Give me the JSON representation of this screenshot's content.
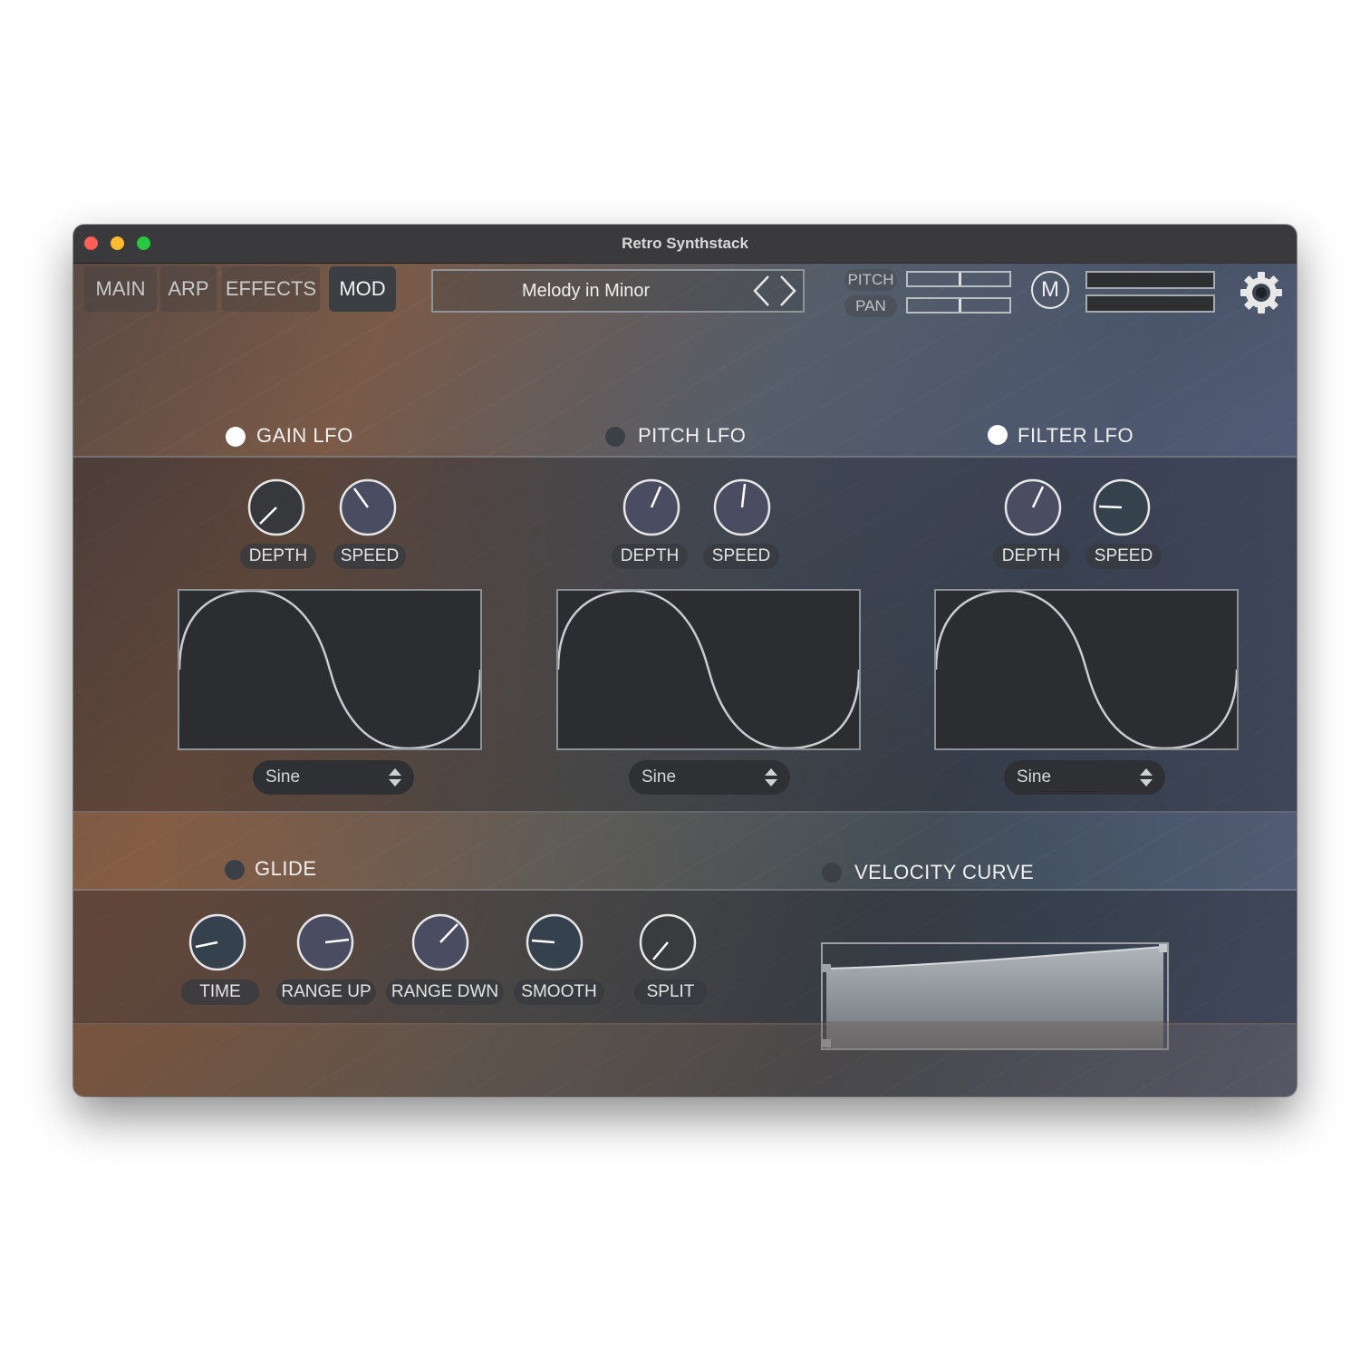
{
  "window": {
    "title": "Retro Synthstack"
  },
  "tabs": [
    {
      "label": "MAIN",
      "active": false
    },
    {
      "label": "ARP",
      "active": false
    },
    {
      "label": "EFFECTS",
      "active": false
    },
    {
      "label": "MOD",
      "active": true
    }
  ],
  "preset": {
    "name": "Melody in Minor"
  },
  "header": {
    "pitch_label": "PITCH",
    "pan_label": "PAN",
    "m_button": "M"
  },
  "lfos": [
    {
      "title": "GAIN LFO",
      "enabled": true,
      "depth_label": "DEPTH",
      "speed_label": "SPEED",
      "waveform": "Sine"
    },
    {
      "title": "PITCH LFO",
      "enabled": false,
      "depth_label": "DEPTH",
      "speed_label": "SPEED",
      "waveform": "Sine"
    },
    {
      "title": "FILTER LFO",
      "enabled": true,
      "depth_label": "DEPTH",
      "speed_label": "SPEED",
      "waveform": "Sine"
    }
  ],
  "glide": {
    "title": "GLIDE",
    "enabled": false,
    "knobs": [
      {
        "label": "TIME"
      },
      {
        "label": "RANGE UP"
      },
      {
        "label": "RANGE DWN"
      },
      {
        "label": "SMOOTH"
      },
      {
        "label": "SPLIT"
      }
    ]
  },
  "velocity": {
    "title": "VELOCITY CURVE",
    "enabled": false
  },
  "colors": {
    "close": "#fe5f57",
    "minimize": "#febc2e",
    "zoom": "#28c840",
    "led_on": "#ffffff",
    "panel_dark": "#2c2d31"
  },
  "icons": [
    "chevron-left-icon",
    "chevron-right-icon",
    "gear-icon",
    "updown-arrows-icon"
  ]
}
